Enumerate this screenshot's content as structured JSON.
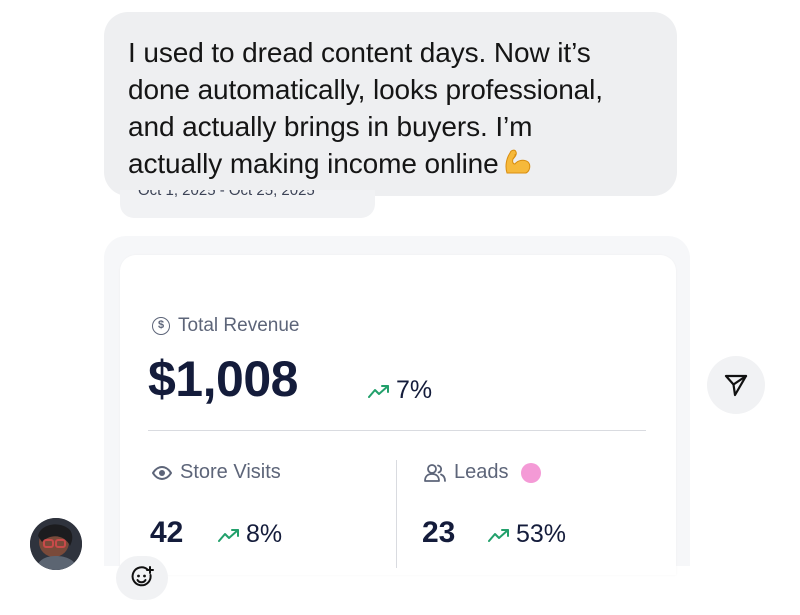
{
  "message": {
    "line1": "I used to dread content days. Now it’s",
    "line2": "done automatically, looks professional,",
    "line3": "and actually brings in buyers. I’m",
    "line4": "actually making income online",
    "emoji": "flexed-biceps-emoji"
  },
  "date_range": "Oct 1, 2025 - Oct 25, 2025",
  "dashboard": {
    "total_revenue": {
      "label": "Total Revenue",
      "value": "$1,008",
      "change": "7%",
      "icon": "dollar-circle-icon"
    },
    "store_visits": {
      "label": "Store Visits",
      "value": "42",
      "change": "8%",
      "icon": "eye-icon"
    },
    "leads": {
      "label": "Leads",
      "value": "23",
      "change": "53%",
      "icon": "users-icon",
      "dot_color": "#f49ad6"
    },
    "trend_color": "#22a06b",
    "value_color": "#141c3b"
  },
  "actions": {
    "share_icon": "send-icon",
    "react_icon": "add-reaction-icon"
  }
}
